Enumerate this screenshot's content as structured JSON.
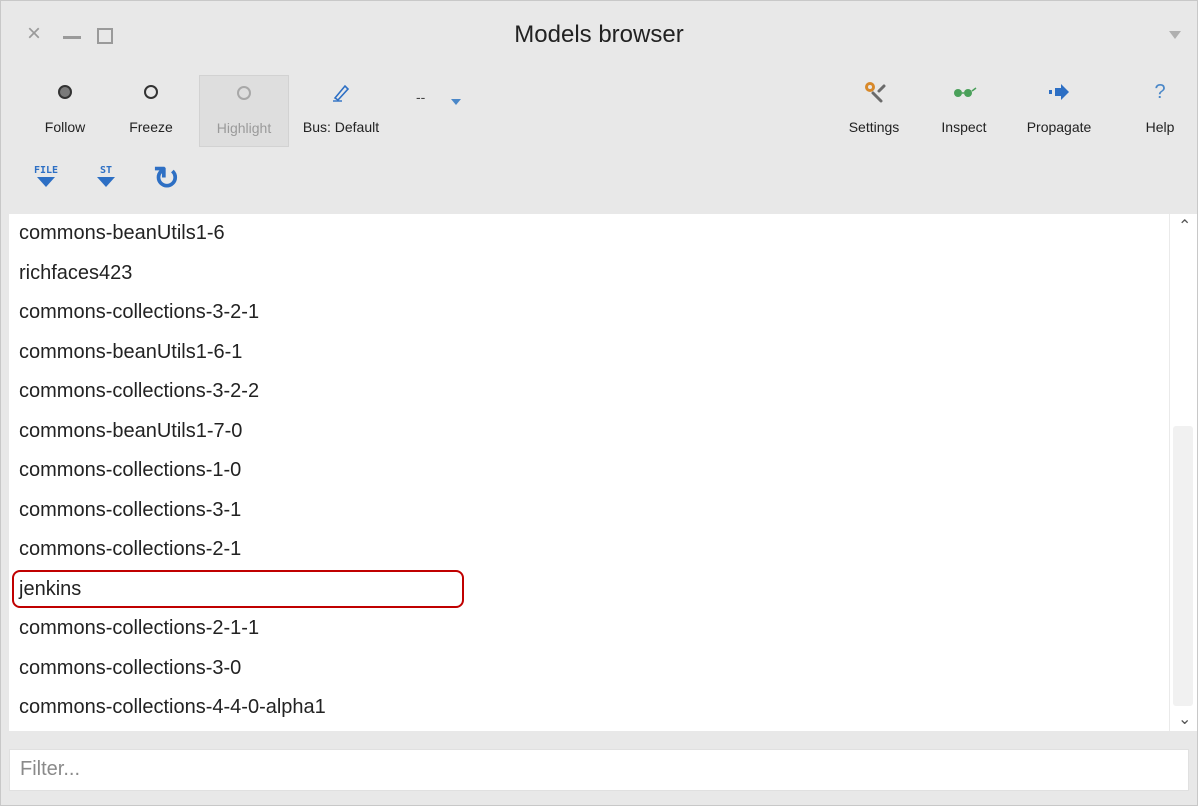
{
  "window": {
    "title": "Models browser",
    "close_glyph": "×"
  },
  "toolbar": {
    "follow": {
      "label": "Follow",
      "icon": "circle-filled-icon"
    },
    "freeze": {
      "label": "Freeze",
      "icon": "circle-outline-icon"
    },
    "highlight": {
      "label": "Highlight",
      "icon": "circle-light-icon",
      "disabled": true
    },
    "bus": {
      "label": "Bus: Default",
      "icon": "pencil-icon"
    },
    "dash": "--",
    "settings": {
      "label": "Settings",
      "icon": "wrench-gear-icon"
    },
    "inspect": {
      "label": "Inspect",
      "icon": "glasses-icon"
    },
    "propagate": {
      "label": "Propagate",
      "icon": "arrow-right-icon"
    },
    "help": {
      "label": "Help",
      "icon": "question-icon",
      "glyph": "?"
    }
  },
  "subtoolbar": {
    "file": {
      "label": "FILE",
      "icon": "file-download-icon"
    },
    "st": {
      "label": "ST",
      "icon": "st-download-icon"
    },
    "refresh": {
      "icon": "refresh-icon",
      "glyph": "↻"
    }
  },
  "list": {
    "items": [
      "commons-beanUtils1-6",
      "richfaces423",
      "commons-collections-3-2-1",
      "commons-beanUtils1-6-1",
      "commons-collections-3-2-2",
      "commons-beanUtils1-7-0",
      "commons-collections-1-0",
      "commons-collections-3-1",
      "commons-collections-2-1",
      "jenkins",
      "commons-collections-2-1-1",
      "commons-collections-3-0",
      "commons-collections-4-4-0-alpha1"
    ],
    "selected_index": 9,
    "scroll_up_glyph": "⌃",
    "scroll_down_glyph": "⌄"
  },
  "filter": {
    "placeholder": "Filter...",
    "value": ""
  },
  "colors": {
    "accent_blue": "#2d6fc4",
    "selection_border": "#c00000",
    "settings_orange": "#d8892a",
    "inspect_green": "#4aa05a"
  }
}
